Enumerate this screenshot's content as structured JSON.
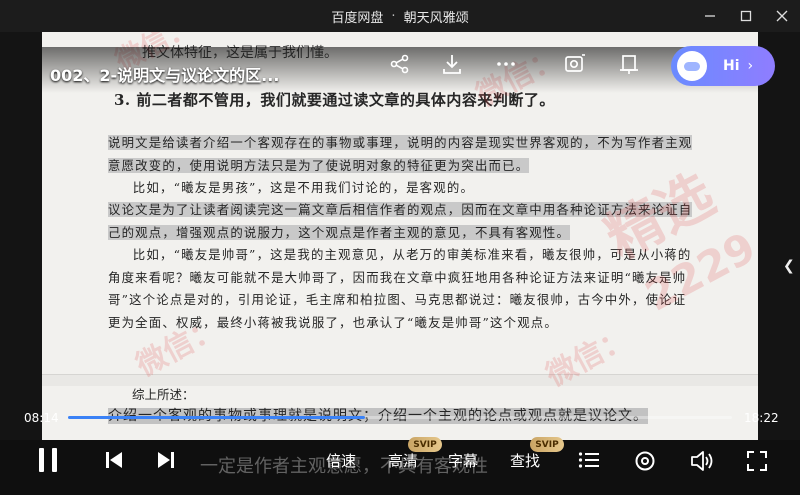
{
  "window": {
    "app_name": "百度网盘",
    "separator": "·",
    "file_name": "朝天风雅颂"
  },
  "video": {
    "title": "002、2-说明文与议论文的区...",
    "current_time": "08:14",
    "total_time": "18:22",
    "progress_fraction": 0.448
  },
  "assistant": {
    "label": "Hi"
  },
  "document": {
    "partial_line": "推文体特征，这是属于我们懂。",
    "heading": "3. 前二者都不管用，我们就要通过读文章的具体内容来判断了。",
    "p1": "说明文是给读者介绍一个客观存在的事物或事理，说明的内容是现实世界客观的，不为写作者主观意愿改变的，使用说明方法只是为了使说明对象的特征更为突出而已。",
    "p2": "比如，“曦友是男孩”，这是不用我们讨论的，是客观的。",
    "p3": "议论文是为了让读者阅读完这一篇文章后相信作者的观点，因而在文章中用各种论证方法来论证自己的观点，增强观点的说服力，这个观点是作者主观的意见，不具有客观性。",
    "p4": "比如，“曦友是帅哥”，这是我的主观意见，从老万的审美标准来看，曦友很帅，可是从小蒋的角度来看呢？曦友可能就不是大帅哥了，因而我在文章中疯狂地用各种论证方法来证明“曦友是帅哥”这个论点是对的，引用论证，毛主席和柏拉图、马克思都说过：曦友很帅，古今中外，使论证更为全面、权威，最终小蒋被我说服了，也承认了“曦友是帅哥”这个观点。",
    "summary_title": "综上所述：",
    "summary": "介绍一个客观的事物或事理就是说明文；介绍一个主观的论点或观点就是议论文。"
  },
  "watermark": {
    "text1": "微信：",
    "text2": "精选",
    "number": "2229"
  },
  "controls": {
    "speed_label": "倍速",
    "quality_label": "高清",
    "subtitle_label": "字幕",
    "search_label": "查找",
    "svip_badge": "SVIP"
  },
  "subtitle_text": "一定是作者主观意愿，不具有客观性",
  "colors": {
    "accent": "#3b82f6",
    "svip_gold": "#d9b878",
    "assistant": "#7a86ff"
  }
}
